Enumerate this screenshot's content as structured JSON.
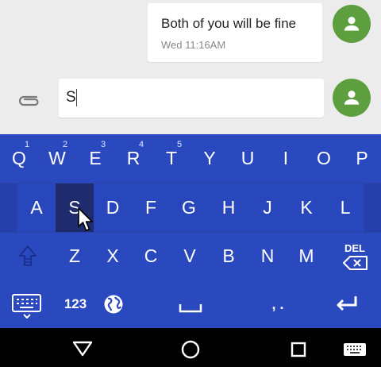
{
  "message": {
    "text": "Both of you will be fine",
    "time": "Wed 11:16AM"
  },
  "compose": {
    "value": "S"
  },
  "keyboard": {
    "row1": [
      {
        "label": "Q",
        "hint": "1"
      },
      {
        "label": "W",
        "hint": "2"
      },
      {
        "label": "E",
        "hint": "3"
      },
      {
        "label": "R",
        "hint": "4"
      },
      {
        "label": "T",
        "hint": "5"
      },
      {
        "label": "Y",
        "hint": ""
      },
      {
        "label": "U",
        "hint": ""
      },
      {
        "label": "I",
        "hint": ""
      },
      {
        "label": "O",
        "hint": ""
      },
      {
        "label": "P",
        "hint": ""
      }
    ],
    "row2": [
      "A",
      "S",
      "D",
      "F",
      "G",
      "H",
      "J",
      "K",
      "L"
    ],
    "row3": [
      "Z",
      "X",
      "C",
      "V",
      "B",
      "N",
      "M"
    ],
    "del_label": "DEL",
    "numbers_label": "123",
    "period_comma": ", ."
  },
  "colors": {
    "keyboard_bg": "#2b49bf",
    "pressed_key": "#1e2c6e",
    "avatar": "#5d9e3e"
  }
}
